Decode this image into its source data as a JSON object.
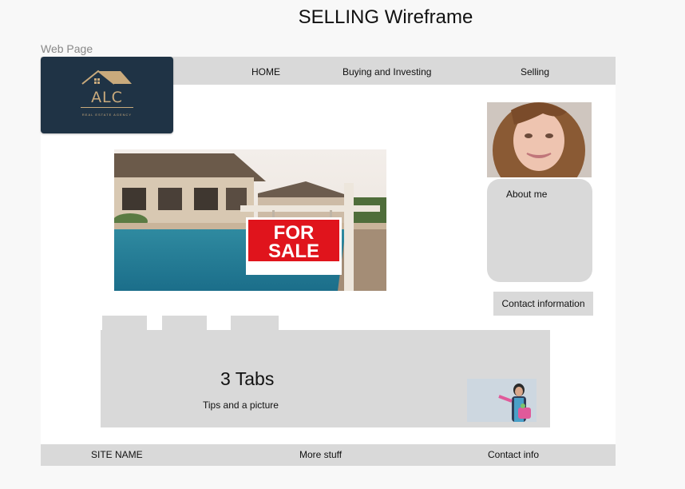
{
  "title": "SELLING Wireframe",
  "page_label": "Web Page",
  "logo": {
    "text": "ALC",
    "subtext": "REAL ESTATE AGENCY"
  },
  "nav": {
    "home": "HOME",
    "buying": "Buying and Investing",
    "selling": "Selling"
  },
  "hero": {
    "sign_line1": "FOR",
    "sign_line2": "SALE"
  },
  "sidebar": {
    "about_title": "About me",
    "contact_button": "Contact information"
  },
  "tabs": {
    "heading": "3 Tabs",
    "subtext": "Tips and a picture"
  },
  "footer": {
    "site_name": "SITE NAME",
    "more": "More stuff",
    "contact": "Contact info"
  },
  "colors": {
    "wire_gray": "#d9d9d9",
    "logo_navy": "#1f3345",
    "logo_gold": "#c9aa7c",
    "sign_red": "#e0141c"
  }
}
